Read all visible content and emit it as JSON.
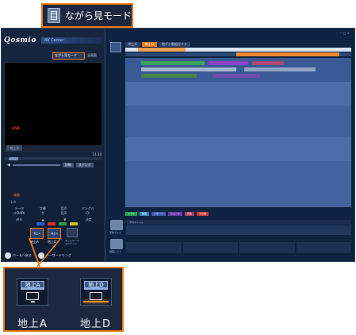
{
  "callout_top": {
    "label": "ながら見モード"
  },
  "left_panel": {
    "brand": "Qosmio",
    "brand_sub": "AV Center",
    "nagara_mini": "ながら見モード",
    "fullscreen": "全画面",
    "live": "LIVE",
    "channel_label": "地上D",
    "time": "14:38",
    "btn_detail": "詳細",
    "btn_stereo": "ステレオ",
    "remote_label": "録画",
    "remote_ch": "1ch",
    "functions": [
      "データ",
      "字幕",
      "音声",
      "アングル"
    ],
    "function_values": [
      "d DATA",
      "字",
      "音声",
      "Ch"
    ],
    "arrow_keys": [
      "戻る",
      "▲",
      "▼",
      "決定"
    ],
    "colors": {
      "blue": "#2a5ad8",
      "red": "#d83020",
      "green": "#2aa040",
      "yellow": "#d8c020"
    },
    "antenna_buttons": [
      "地上A",
      "地上D"
    ],
    "net_label": "ネットワーク コンテンツ",
    "bottom_buttons": [
      "ホームへ戻る",
      "キーワードリング"
    ]
  },
  "right_panel": {
    "tabs": [
      "地上A",
      "地上D",
      "地デジ番組ガイド"
    ],
    "program_colors": [
      "#3cb050",
      "#9a3fd0",
      "#c04870",
      "#4a8a3a",
      "#7a4ab0"
    ],
    "legend": [
      {
        "label": "ドラマ",
        "color": "#1fa050"
      },
      {
        "label": "映画",
        "color": "#2a8ac0"
      },
      {
        "label": "スポーツ",
        "color": "#3a5aa8"
      },
      {
        "label": "ニュース",
        "color": "#6a3aa8"
      },
      {
        "label": "音楽",
        "color": "#a83a5a"
      },
      {
        "label": "その他",
        "color": "#c03a3a"
      }
    ],
    "rec_head": "予約タイトル",
    "rec_icons": [
      "予約ガイド",
      "録画リスト"
    ]
  },
  "callout_bottom": {
    "buttons": [
      {
        "bar": "地上A",
        "label": "地上A",
        "selected": false
      },
      {
        "bar": "地上D",
        "label": "地上D",
        "selected": true
      }
    ]
  },
  "accent_color": "#ee7a10"
}
